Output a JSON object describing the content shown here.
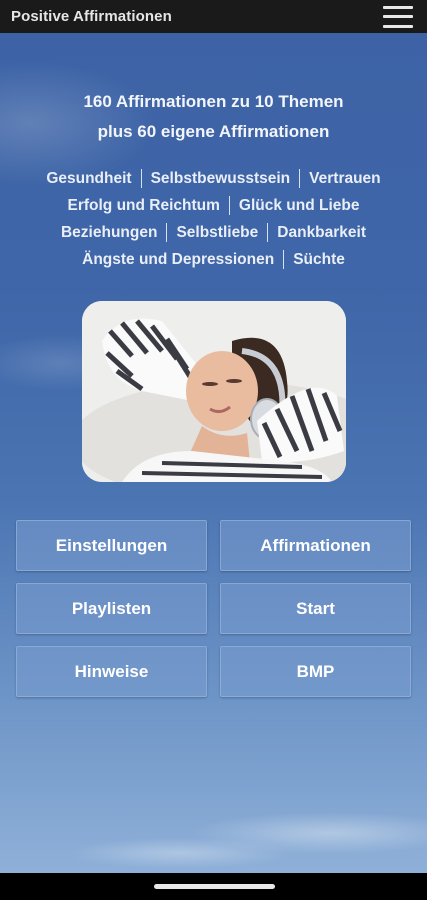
{
  "app": {
    "title": "Positive Affirmationen"
  },
  "header": {
    "line1": "160 Affirmationen zu 10 Themen",
    "line2": "plus 60 eigene Affirmationen"
  },
  "topics": [
    [
      "Gesundheit",
      "Selbstbewusstsein",
      "Vertrauen"
    ],
    [
      "Erfolg und Reichtum",
      "Glück und Liebe"
    ],
    [
      "Beziehungen",
      "Selbstliebe",
      "Dankbarkeit"
    ],
    [
      "Ängste und Depressionen",
      "Süchte"
    ]
  ],
  "buttons": {
    "settings": "Einstellungen",
    "affirmations": "Affirmationen",
    "playlists": "Playlisten",
    "start": "Start",
    "hints": "Hinweise",
    "bmp": "BMP"
  },
  "colors": {
    "sky_top": "#3d63a6",
    "sky_bottom": "#8fb0d8",
    "button_fill": "#789bcd",
    "title_bar": "#1a1a1a"
  },
  "icons": [
    "hamburger-menu-icon",
    "home-indicator"
  ]
}
